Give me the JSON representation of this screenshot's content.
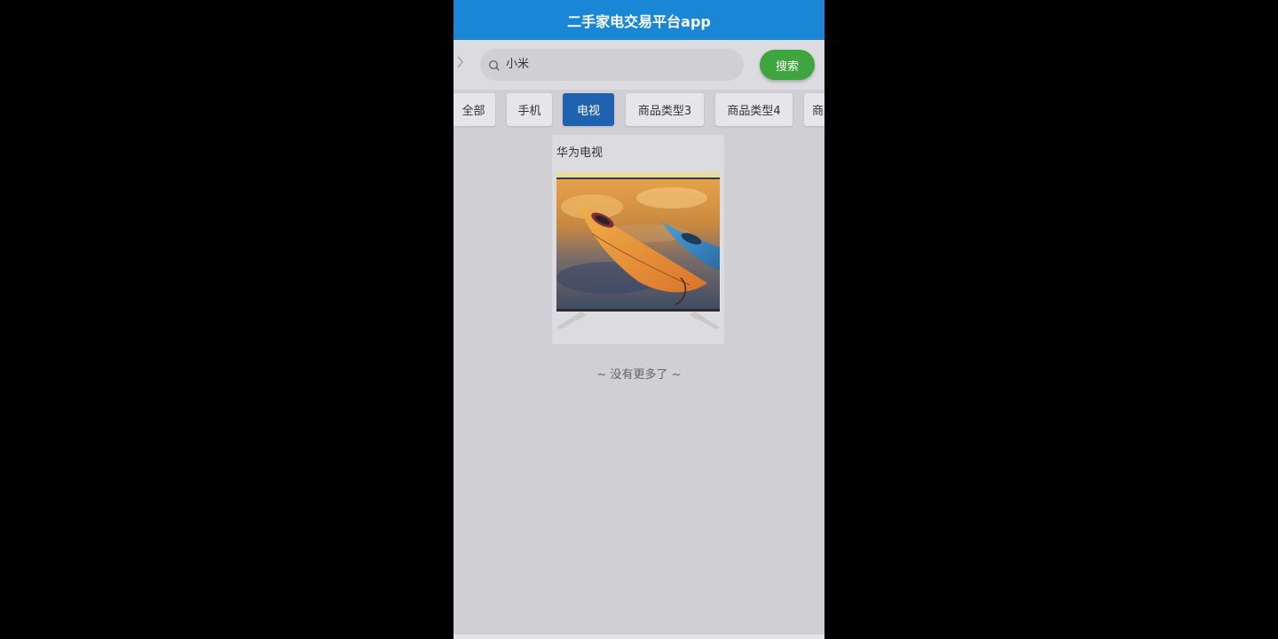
{
  "app": {
    "title": "二手家电交易平台app"
  },
  "search": {
    "value": "小米",
    "button_label": "搜索"
  },
  "categories": [
    {
      "label": "全部",
      "active": false
    },
    {
      "label": "手机",
      "active": false
    },
    {
      "label": "电视",
      "active": true
    },
    {
      "label": "商品类型3",
      "active": false
    },
    {
      "label": "商品类型4",
      "active": false
    },
    {
      "label": "商",
      "active": false
    }
  ],
  "products": [
    {
      "name": "华为电视",
      "image": "kayak-tv-image"
    }
  ],
  "list_end_text": "~ 没有更多了 ~",
  "colors": {
    "header": "#1a87d6",
    "search_button": "#3fa63f",
    "active_tab": "#1e62b0",
    "background": "#d0cfd3"
  },
  "icons": {
    "back": "chevron-right-icon",
    "search": "search-icon"
  }
}
